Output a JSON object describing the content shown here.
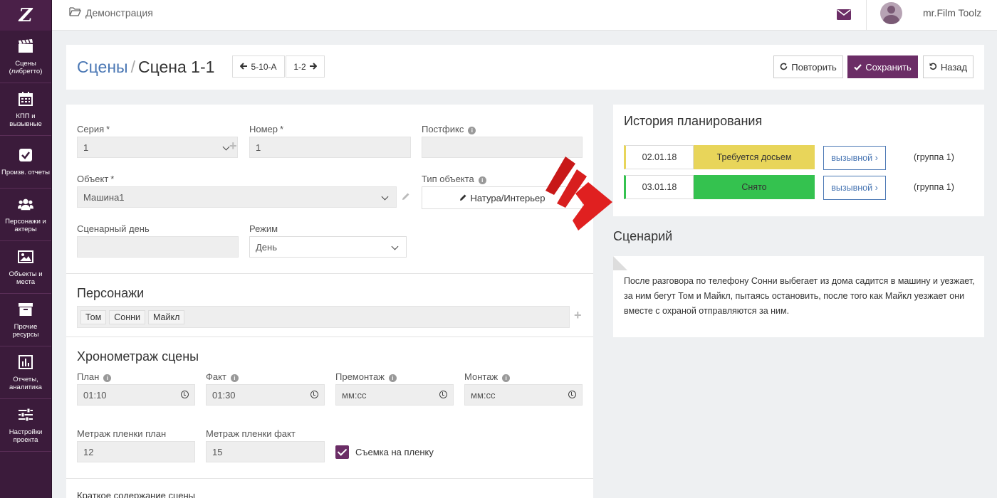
{
  "brand": {
    "logo_letter": "Z"
  },
  "sidebar": {
    "items": [
      {
        "label": "Сцены (либретто)",
        "icon": "clapperboard-icon"
      },
      {
        "label": "КПП и вызывные",
        "icon": "calendar-icon"
      },
      {
        "label": "Произв. отчеты",
        "icon": "checkbox-icon"
      },
      {
        "label": "Персонажи и актеры",
        "icon": "users-icon"
      },
      {
        "label": "Объекты и места",
        "icon": "image-icon"
      },
      {
        "label": "Прочие ресурсы",
        "icon": "archive-icon"
      },
      {
        "label": "Отчеты, аналитика",
        "icon": "bar-chart-icon"
      },
      {
        "label": "Настройки проекта",
        "icon": "sliders-icon"
      }
    ]
  },
  "topbar": {
    "breadcrumb": "Демонстрация",
    "user_name": "mr.Film Toolz"
  },
  "header": {
    "title_link": "Сцены",
    "separator": "/",
    "title": "Сцена 1-1",
    "prev_scene": "5-10-А",
    "next_scene": "1-2",
    "repeat_label": "Повторить",
    "save_label": "Сохранить",
    "back_label": "Назад"
  },
  "form": {
    "series": {
      "label": "Серия",
      "required": "*",
      "value": "1"
    },
    "number": {
      "label": "Номер",
      "required": "*",
      "value": "1"
    },
    "postfix": {
      "label": "Постфикс",
      "value": ""
    },
    "object": {
      "label": "Объект",
      "required": "*",
      "value": "Машина1"
    },
    "object_type": {
      "label": "Тип объекта",
      "value": "Натура/Интерьер"
    },
    "script_day": {
      "label": "Сценарный день",
      "value": ""
    },
    "mode": {
      "label": "Режим",
      "value": "День"
    },
    "characters": {
      "title": "Персонажи",
      "tags": [
        "Том",
        "Сонни",
        "Майкл"
      ]
    },
    "timing": {
      "title": "Хронометраж сцены",
      "plan": {
        "label": "План",
        "value": "01:10"
      },
      "fact": {
        "label": "Факт",
        "value": "01:30"
      },
      "premontage": {
        "label": "Премонтаж",
        "value": "мм:сс"
      },
      "montage": {
        "label": "Монтаж",
        "value": "мм:сс"
      },
      "film_plan": {
        "label": "Метраж пленки план",
        "value": "12"
      },
      "film_fact": {
        "label": "Метраж пленки факт",
        "value": "15"
      },
      "film_shoot": {
        "label": "Съемка на пленку",
        "checked": true
      }
    },
    "summary_label": "Краткое содержание сцены"
  },
  "history": {
    "title": "История планирования",
    "rows": [
      {
        "date": "02.01.18",
        "status": "Требуется досьем",
        "status_color": "#e8d55a",
        "marker_color": "#e8d55a",
        "button": "вызывной",
        "group": "(группа 1)"
      },
      {
        "date": "03.01.18",
        "status": "Снято",
        "status_color": "#34c24f",
        "marker_color": "#34c24f",
        "button": "вызывной",
        "group": "(группа 1)"
      }
    ]
  },
  "scenario": {
    "title": "Сценарий",
    "text": "После разговора по телефону Сонни выбегает из дома садится в машину и уезжает, за ним бегут Том и Майкл, пытаясь остановить, после того как Майкл уезжает они вместе с охраной отправляются за ним."
  },
  "colors": {
    "brand": "#6b2d66",
    "sidebar": "#3b1b3b",
    "link": "#4a77b4",
    "arrow": "#e02020"
  }
}
